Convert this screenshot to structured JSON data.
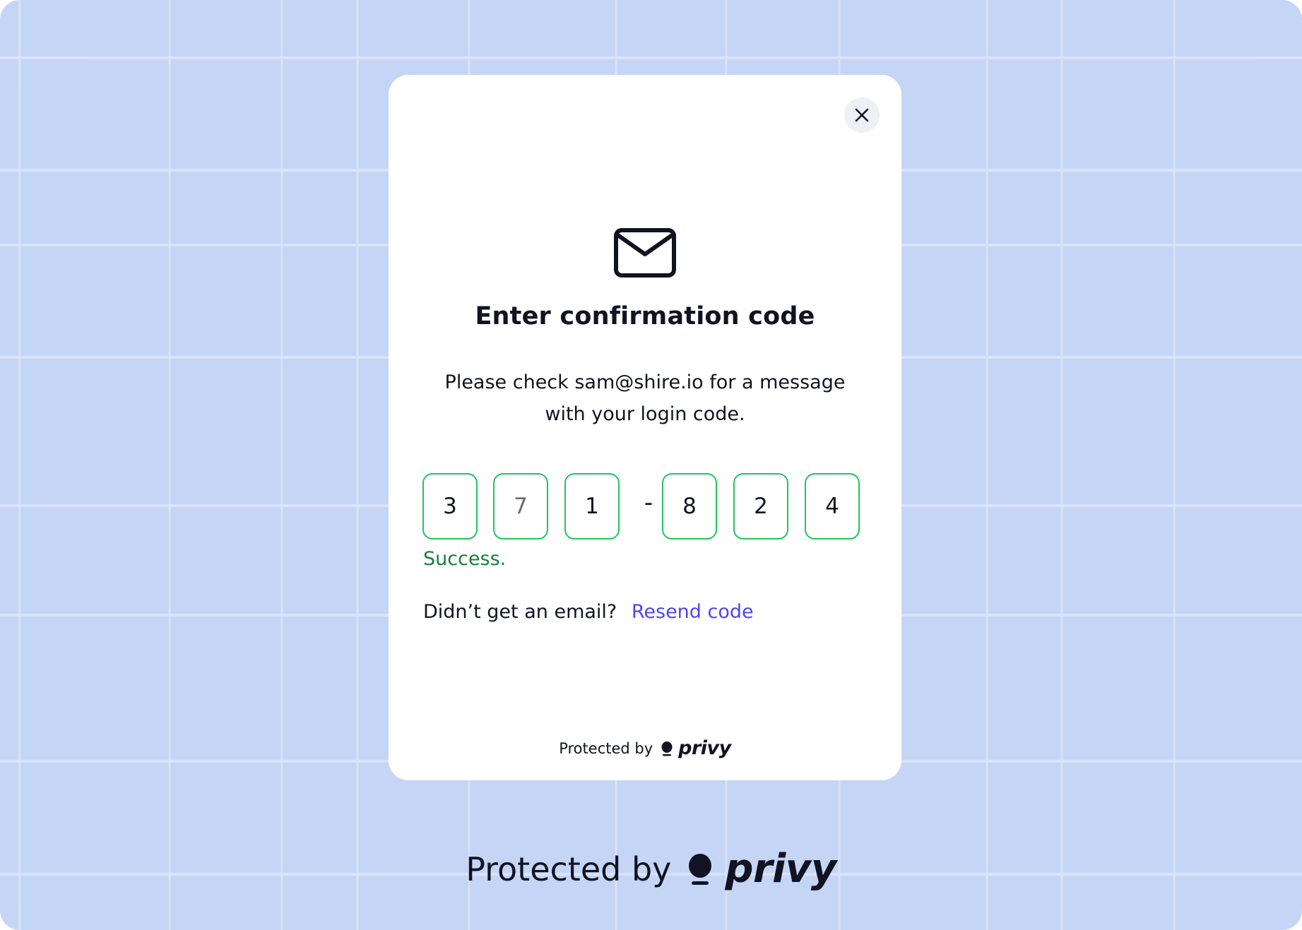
{
  "modal": {
    "close_icon": "close-icon",
    "mail_icon": "envelope-icon",
    "title": "Enter confirmation code",
    "description": "Please check sam@shire.io for a message with your login code.",
    "code_digits": [
      "3",
      "7",
      "1",
      "8",
      "2",
      "4"
    ],
    "code_separator": "-",
    "status": "Success.",
    "resend_prompt": "Didn’t get an email?",
    "resend_link": "Resend code",
    "footer_text": "Protected by",
    "footer_brand": "privy"
  },
  "page_footer": {
    "text": "Protected by",
    "brand": "privy"
  },
  "colors": {
    "background": "#c5d5f5",
    "code_border": "#22c55e",
    "success_text": "#15803d",
    "link": "#4f46e5",
    "text": "#111322"
  }
}
